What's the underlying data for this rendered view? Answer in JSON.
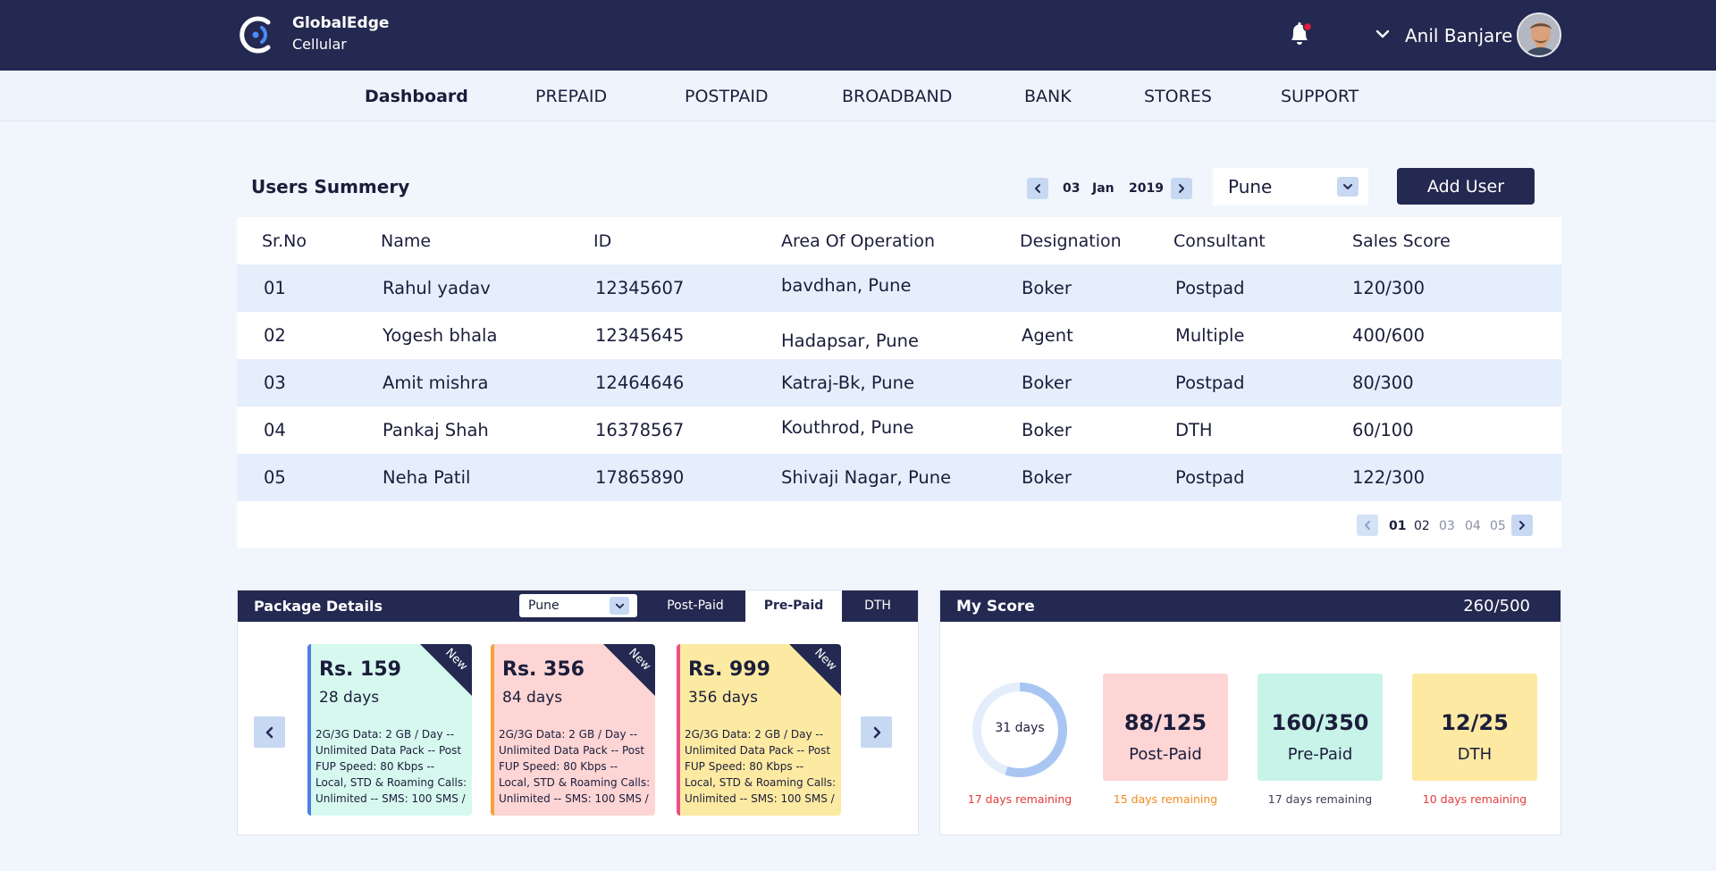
{
  "brand": {
    "line1": "GlobalEdge",
    "line2": "Cellular"
  },
  "user": {
    "name": "Anil Banjare"
  },
  "nav": [
    {
      "label": "Dashboard",
      "active": true
    },
    {
      "label": "PREPAID"
    },
    {
      "label": "POSTPAID"
    },
    {
      "label": "BROADBAND"
    },
    {
      "label": "BANK"
    },
    {
      "label": "STORES"
    },
    {
      "label": "SUPPORT"
    }
  ],
  "users_summary": {
    "title": "Users Summery",
    "date": {
      "day": "03",
      "month": "Jan",
      "year": "2019"
    },
    "city": "Pune",
    "add_user_label": "Add User",
    "columns": [
      "Sr.No",
      "Name",
      "ID",
      "Area Of Operation",
      "Designation",
      "Consultant",
      "Sales Score"
    ],
    "rows": [
      {
        "sr": "01",
        "name": "Rahul yadav",
        "id": "12345607",
        "area": "bavdhan, Pune",
        "designation": "Boker",
        "consultant": "Postpad",
        "score": "120/300"
      },
      {
        "sr": "02",
        "name": "Yogesh bhala",
        "id": "12345645",
        "area": "Hadapsar, Pune",
        "designation": "Agent",
        "consultant": "Multiple",
        "score": "400/600"
      },
      {
        "sr": "03",
        "name": "Amit mishra",
        "id": "12464646",
        "area": "Katraj-Bk, Pune",
        "designation": "Boker",
        "consultant": "Postpad",
        "score": "80/300"
      },
      {
        "sr": "04",
        "name": "Pankaj Shah",
        "id": "16378567",
        "area": "Kouthrod, Pune",
        "designation": "Boker",
        "consultant": "DTH",
        "score": "60/100"
      },
      {
        "sr": "05",
        "name": "Neha Patil",
        "id": "17865890",
        "area": "Shivaji Nagar, Pune",
        "designation": "Boker",
        "consultant": "Postpad",
        "score": "122/300"
      }
    ],
    "pages": [
      "01",
      "02",
      "03",
      "04",
      "05"
    ],
    "current_page": "01"
  },
  "package_details": {
    "title": "Package Details",
    "city": "Pune",
    "tabs": [
      "Post-Paid",
      "Pre-Paid",
      "DTH"
    ],
    "active_tab": "Pre-Paid",
    "plans": [
      {
        "price": "Rs. 159",
        "days": "28 days",
        "badge": "New",
        "bg": "#d7f8ef",
        "stripe": "#4f7fe6",
        "desc": "2G/3G Data: 2 GB / Day -- Unlimited Data Pack -- Post FUP Speed: 80 Kbps -- Local, STD & Roaming Calls: Unlimited -- SMS: 100 SMS /"
      },
      {
        "price": "Rs. 356",
        "days": "84 days",
        "badge": "New",
        "bg": "#fdd5d5",
        "stripe": "#f4a23a",
        "desc": "2G/3G Data: 2 GB / Day -- Unlimited Data Pack -- Post FUP Speed: 80 Kbps -- Local, STD & Roaming Calls: Unlimited -- SMS: 100 SMS /"
      },
      {
        "price": "Rs. 999",
        "days": "356 days",
        "badge": "New",
        "bg": "#fdeaa2",
        "stripe": "#ec4f8a",
        "desc": "2G/3G Data: 2 GB / Day -- Unlimited Data Pack -- Post FUP Speed: 80 Kbps -- Local, STD & Roaming Calls: Unlimited -- SMS: 100 SMS /"
      }
    ]
  },
  "my_score": {
    "title": "My Score",
    "total": "260/500",
    "cycle": {
      "label": "31 days",
      "remaining": "17 days remaining",
      "progress": 0.55,
      "remaining_color": "#e33b3b"
    },
    "tiles": [
      {
        "value": "88/125",
        "label": "Post-Paid",
        "remaining": "15 days remaining",
        "bg": "#fdd5d5",
        "remaining_color": "#f08a1c"
      },
      {
        "value": "160/350",
        "label": "Pre-Paid",
        "remaining": "17 days remaining",
        "bg": "#c8f3e8",
        "remaining_color": "#3a3d52"
      },
      {
        "value": "12/25",
        "label": "DTH",
        "remaining": "10 days remaining",
        "bg": "#fde9a1",
        "remaining_color": "#e33b3b"
      }
    ]
  },
  "colors": {
    "navy": "#232950",
    "accent_light": "#c7d8f3",
    "row_alt": "#e5eefb",
    "page_bg": "#f1f6fd",
    "notification_dot": "#e51b3c"
  },
  "icons": [
    "brand-logo-icon",
    "bell-icon",
    "chevron-down-icon",
    "chevron-left-icon",
    "chevron-right-icon"
  ]
}
